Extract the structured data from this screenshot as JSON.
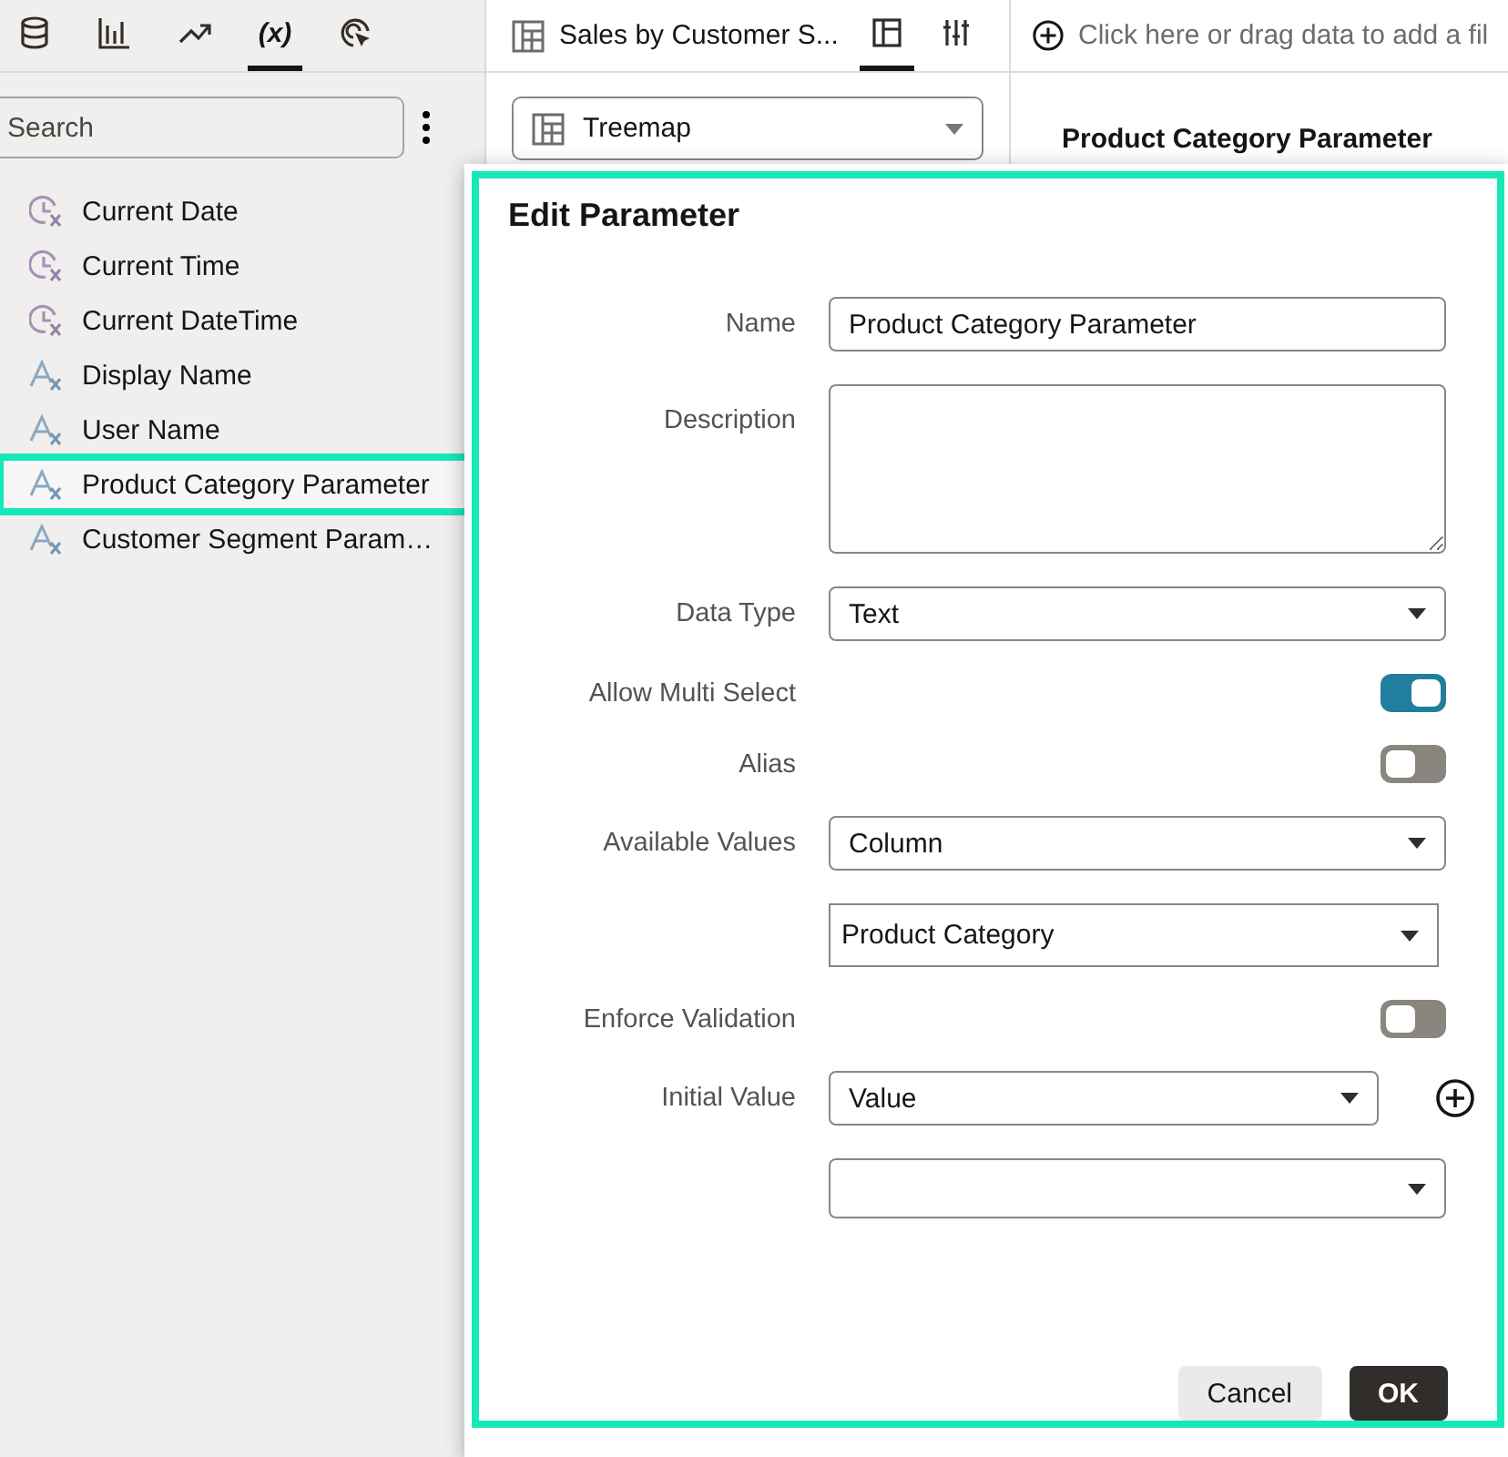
{
  "left_tabs": [
    {
      "kind": "database",
      "selected": false
    },
    {
      "kind": "bars",
      "selected": false
    },
    {
      "kind": "trend",
      "selected": false
    },
    {
      "kind": "variable",
      "label": "(x)",
      "selected": true
    },
    {
      "kind": "cursor",
      "selected": false
    }
  ],
  "search": {
    "placeholder": "Search"
  },
  "variables": [
    {
      "kind": "datetime",
      "label": "Current Date",
      "highlighted": false
    },
    {
      "kind": "datetime",
      "label": "Current Time",
      "highlighted": false
    },
    {
      "kind": "datetime",
      "label": "Current DateTime",
      "highlighted": false
    },
    {
      "kind": "text",
      "label": "Display Name",
      "highlighted": false
    },
    {
      "kind": "text",
      "label": "User Name",
      "highlighted": false
    },
    {
      "kind": "text",
      "label": "Product Category Parameter",
      "highlighted": true
    },
    {
      "kind": "text",
      "label": "Customer Segment Param…",
      "highlighted": false
    }
  ],
  "middle": {
    "title": "Sales by Customer S...",
    "tabs": [
      {
        "kind": "layout",
        "selected": true
      },
      {
        "kind": "properties",
        "selected": false
      }
    ],
    "chart_type": "Treemap"
  },
  "right": {
    "filter_hint": "Click here or drag data to add a fil",
    "heading": "Product Category Parameter"
  },
  "dialog": {
    "title": "Edit Parameter",
    "highlighted": true,
    "rows": [
      {
        "label": "Name",
        "kind": "text",
        "value": "Product Category Parameter"
      },
      {
        "label": "Description",
        "kind": "textarea"
      },
      {
        "label": "Data Type",
        "kind": "select",
        "value": "Text"
      },
      {
        "label": "Allow Multi Select",
        "kind": "toggle",
        "on": true
      },
      {
        "label": "Alias",
        "kind": "toggle",
        "on": false
      },
      {
        "label": "Available Values",
        "kind": "select",
        "value": "Column"
      },
      {
        "kind": "select",
        "value": "Product Category"
      },
      {
        "label": "Enforce Validation",
        "kind": "toggle",
        "on": false
      },
      {
        "label": "Initial Value",
        "kind": "select",
        "value": "Value",
        "add_button": true
      },
      {
        "kind": "select"
      }
    ],
    "buttons": [
      {
        "label": "Cancel",
        "kind": "secondary"
      },
      {
        "label": "OK",
        "kind": "primary"
      }
    ]
  }
}
